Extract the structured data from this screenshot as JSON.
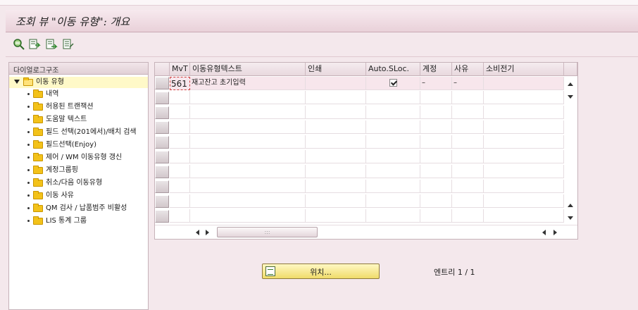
{
  "window": {
    "title": "조회 뷰 \"이동 유형\": 개요"
  },
  "toolbar": {
    "buttons": [
      {
        "name": "choose-icon"
      },
      {
        "name": "export-icon"
      },
      {
        "name": "next-icon"
      },
      {
        "name": "other-icon"
      }
    ]
  },
  "tree": {
    "header": "다이얼로그구조",
    "root": "이동 유형",
    "items": [
      "내역",
      "허용된 트랜잭션",
      "도움말 텍스트",
      "필드 선택(201에서)/배치 검색",
      "필드선택(Enjoy)",
      "제어 / WM 이동유형 갱신",
      "계정그룹핑",
      "취소/다음 이동유형",
      "이동 사유",
      "QM 검사 / 납품범주 비활성",
      "LIS 통계 그룹"
    ]
  },
  "table": {
    "columns": [
      "MvT",
      "이동유형텍스트",
      "인쇄",
      "Auto.SLoc.",
      "계정",
      "사유",
      "소비전기"
    ],
    "rows": [
      {
        "mvt": "561",
        "text": "재고잔고 초기입력",
        "print": "",
        "auto_sloc": true,
        "account": "–",
        "reason": "–",
        "consumption": ""
      }
    ]
  },
  "bottom": {
    "position_button": "위치...",
    "entries": "엔트리 1 / 1"
  },
  "colors": {
    "background": "#f4e8ec",
    "accent": "#e9d1d9",
    "selected": "#fff9c8"
  }
}
